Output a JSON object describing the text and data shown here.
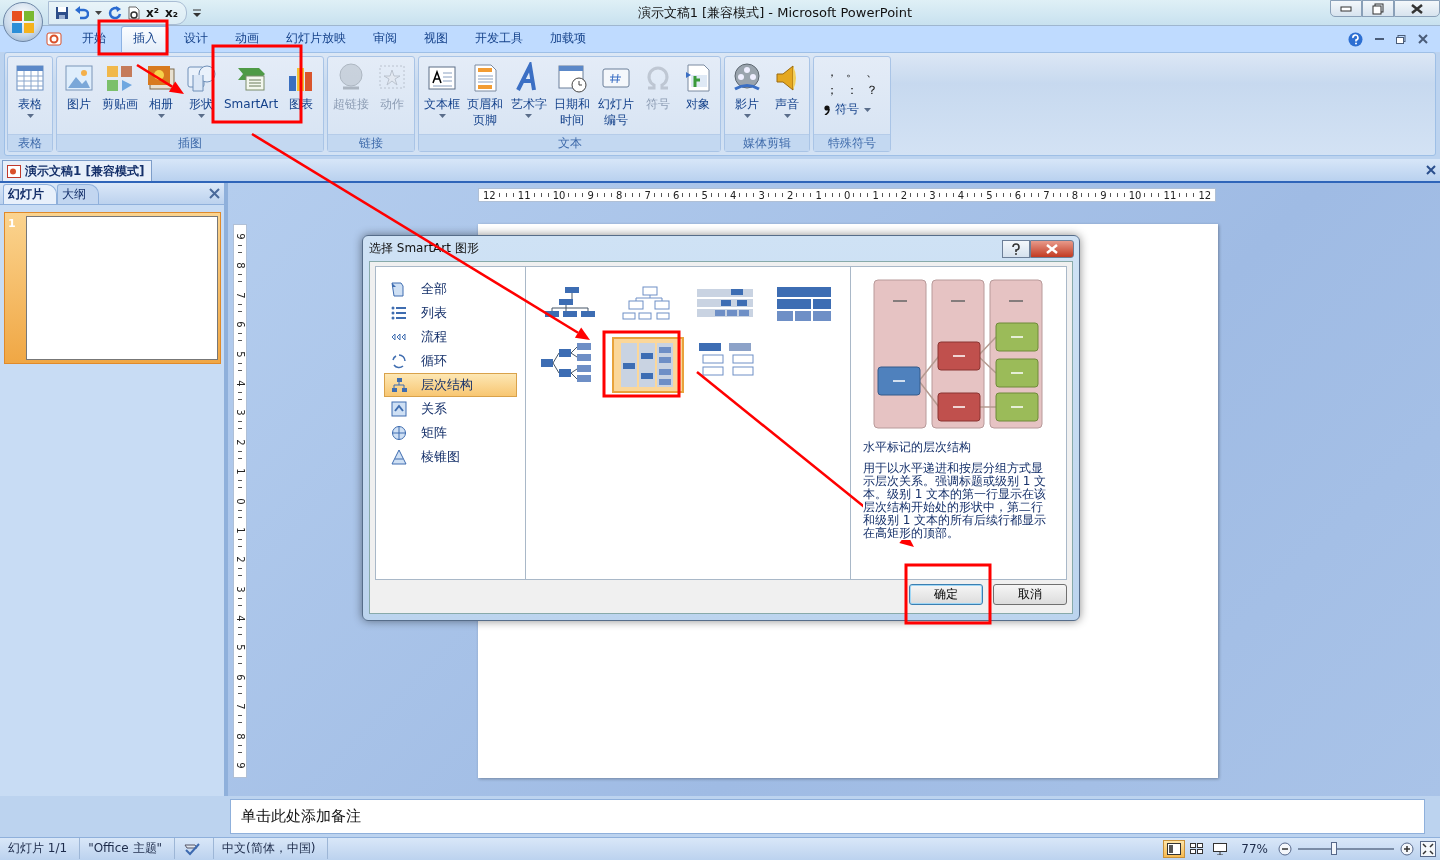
{
  "window": {
    "title": "演示文稿1 [兼容模式] - Microsoft PowerPoint"
  },
  "quick_access": {
    "superscript": "x²",
    "subscript": "x₂"
  },
  "tabs": [
    {
      "label": "开始",
      "selected": false
    },
    {
      "label": "插入",
      "selected": true
    },
    {
      "label": "设计",
      "selected": false
    },
    {
      "label": "动画",
      "selected": false
    },
    {
      "label": "幻灯片放映",
      "selected": false
    },
    {
      "label": "审阅",
      "selected": false
    },
    {
      "label": "视图",
      "selected": false
    },
    {
      "label": "开发工具",
      "selected": false
    },
    {
      "label": "加载项",
      "selected": false
    }
  ],
  "ribbon": {
    "groups": [
      {
        "label": "表格",
        "kind": "buttons",
        "buttons": [
          {
            "label": "表格",
            "dropdown": true,
            "disabled": false
          }
        ]
      },
      {
        "label": "插图",
        "kind": "buttons",
        "buttons": [
          {
            "label": "图片",
            "dropdown": false,
            "disabled": false
          },
          {
            "label": "剪贴画",
            "dropdown": false,
            "disabled": false
          },
          {
            "label": "相册",
            "dropdown": true,
            "disabled": false
          },
          {
            "label": "形状",
            "dropdown": true,
            "disabled": false
          },
          {
            "label": "SmartArt",
            "dropdown": false,
            "disabled": false
          },
          {
            "label": "图表",
            "dropdown": false,
            "disabled": false
          }
        ]
      },
      {
        "label": "链接",
        "kind": "buttons",
        "buttons": [
          {
            "label": "超链接",
            "dropdown": false,
            "disabled": true
          },
          {
            "label": "动作",
            "dropdown": false,
            "disabled": true
          }
        ]
      },
      {
        "label": "文本",
        "kind": "buttons",
        "buttons": [
          {
            "label": "文本框",
            "dropdown": true,
            "disabled": false
          },
          {
            "label": "页眉和页脚",
            "dropdown": false,
            "disabled": false
          },
          {
            "label": "艺术字",
            "dropdown": true,
            "disabled": false
          },
          {
            "label": "日期和时间",
            "dropdown": false,
            "disabled": false
          },
          {
            "label": "幻灯片编号",
            "dropdown": false,
            "disabled": false
          },
          {
            "label": "符号",
            "dropdown": false,
            "disabled": true
          },
          {
            "label": "对象",
            "dropdown": false,
            "disabled": false
          }
        ]
      },
      {
        "label": "媒体剪辑",
        "kind": "buttons",
        "buttons": [
          {
            "label": "影片",
            "dropdown": true,
            "disabled": false
          },
          {
            "label": "声音",
            "dropdown": true,
            "disabled": false
          }
        ]
      },
      {
        "label": "特殊符号",
        "kind": "symbols",
        "symbols": [
          "，",
          "。",
          "、",
          "；",
          "：",
          "？"
        ],
        "buttons": [
          {
            "label": "符号",
            "dropdown": true,
            "disabled": false
          }
        ]
      }
    ]
  },
  "document_tab": {
    "label": "演示文稿1 [兼容模式]"
  },
  "slide_pane": {
    "tabs": [
      {
        "label": "幻灯片",
        "selected": true
      },
      {
        "label": "大纲",
        "selected": false
      }
    ],
    "slides": [
      {
        "number": "1",
        "selected": true
      }
    ]
  },
  "rulers": {
    "horizontal": [
      "12",
      "11",
      "10",
      "9",
      "8",
      "7",
      "6",
      "5",
      "4",
      "3",
      "2",
      "1",
      "0",
      "1",
      "2",
      "3",
      "4",
      "5",
      "6",
      "7",
      "8",
      "9",
      "10",
      "11",
      "12"
    ],
    "vertical": [
      "9",
      "8",
      "7",
      "6",
      "5",
      "4",
      "3",
      "2",
      "1",
      "0",
      "1",
      "2",
      "3",
      "4",
      "5",
      "6",
      "7",
      "8",
      "9"
    ]
  },
  "dialog": {
    "title": "选择 SmartArt 图形",
    "categories": [
      {
        "label": "全部",
        "selected": false
      },
      {
        "label": "列表",
        "selected": false
      },
      {
        "label": "流程",
        "selected": false
      },
      {
        "label": "循环",
        "selected": false
      },
      {
        "label": "层次结构",
        "selected": true
      },
      {
        "label": "关系",
        "selected": false
      },
      {
        "label": "矩阵",
        "selected": false
      },
      {
        "label": "棱锥图",
        "selected": false
      }
    ],
    "layouts": [
      {
        "selected": false
      },
      {
        "selected": false
      },
      {
        "selected": false
      },
      {
        "selected": false
      },
      {
        "selected": false
      },
      {
        "selected": true
      },
      {
        "selected": false
      }
    ],
    "preview": {
      "title": "水平标记的层次结构",
      "description": "用于以水平递进和按层分组方式显示层次关系。强调标题或级别 1 文本。级别 1 文本的第一行显示在该层次结构开始处的形状中，第二行和级别 1 文本的所有后续行都显示在高矩形的顶部。"
    },
    "buttons": [
      "确定",
      "取消"
    ]
  },
  "notes": {
    "prompt": "单击此处添加备注"
  },
  "status_bar": {
    "slide": "幻灯片 1/1",
    "theme": "\"Office 主题\"",
    "language": "中文(简体，中国)",
    "views": [
      {
        "selected": true
      },
      {
        "selected": false
      },
      {
        "selected": false
      }
    ],
    "zoom": "77%",
    "zoom_slider": {
      "level": 0.38
    }
  }
}
